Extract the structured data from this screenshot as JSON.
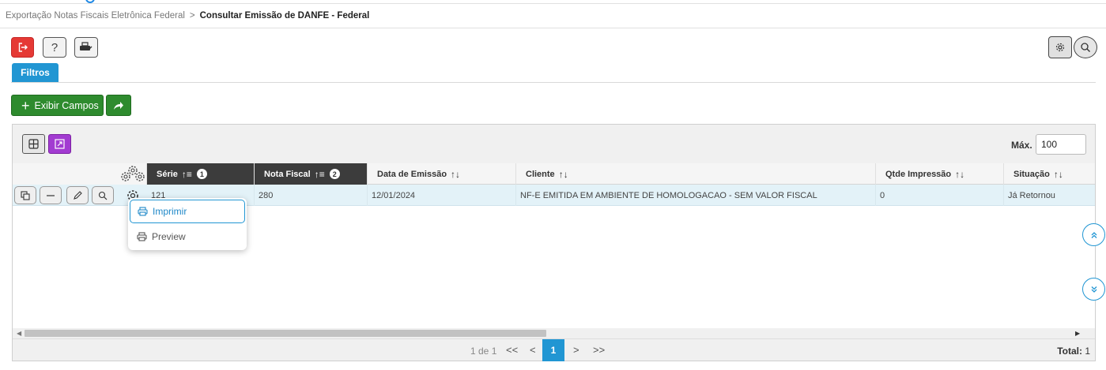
{
  "breadcrumb": {
    "parent": "Exportação Notas Fiscais Eletrônica Federal",
    "separator": ">",
    "current": "Consultar Emissão de DANFE - Federal"
  },
  "toolbar": {
    "exit_icon": "exit-icon",
    "help_label": "?",
    "print_icon": "printer-icon",
    "settings_icon": "gear-icon",
    "search_icon": "search-icon"
  },
  "tabs": [
    {
      "label": "Filtros"
    }
  ],
  "actions": {
    "exibir_campos_label": "Exibir Campos",
    "share_icon": "share-arrow-icon"
  },
  "grid": {
    "max_label": "Máx.",
    "max_value": "100",
    "columns": [
      {
        "label": "Série",
        "order": "1"
      },
      {
        "label": "Nota Fiscal",
        "order": "2"
      },
      {
        "label": "Data de Emissão"
      },
      {
        "label": "Cliente"
      },
      {
        "label": "Qtde Impressão"
      },
      {
        "label": "Situação"
      }
    ],
    "rows": [
      {
        "serie": "121",
        "nota_fiscal": "280",
        "data_emissao": "12/01/2024",
        "cliente": "NF-E EMITIDA EM AMBIENTE DE HOMOLOGACAO - SEM VALOR FISCAL",
        "qtde_impressao": "0",
        "situacao": "Já Retornou"
      }
    ],
    "context_menu": [
      {
        "label": "Imprimir",
        "icon": "printer-icon"
      },
      {
        "label": "Preview",
        "icon": "printer-icon"
      }
    ],
    "pager": {
      "info": "1 de 1",
      "first": "<<",
      "prev": "<",
      "current": "1",
      "next": ">",
      "last": ">>",
      "total_label": "Total:",
      "total_value": "1"
    }
  },
  "colors": {
    "accent": "#2196d3",
    "danger": "#e53935",
    "success": "#2e8b2e",
    "purple": "#a23bd1",
    "header_dark": "#3c3c3c",
    "row_selected": "#e3f2f8"
  }
}
